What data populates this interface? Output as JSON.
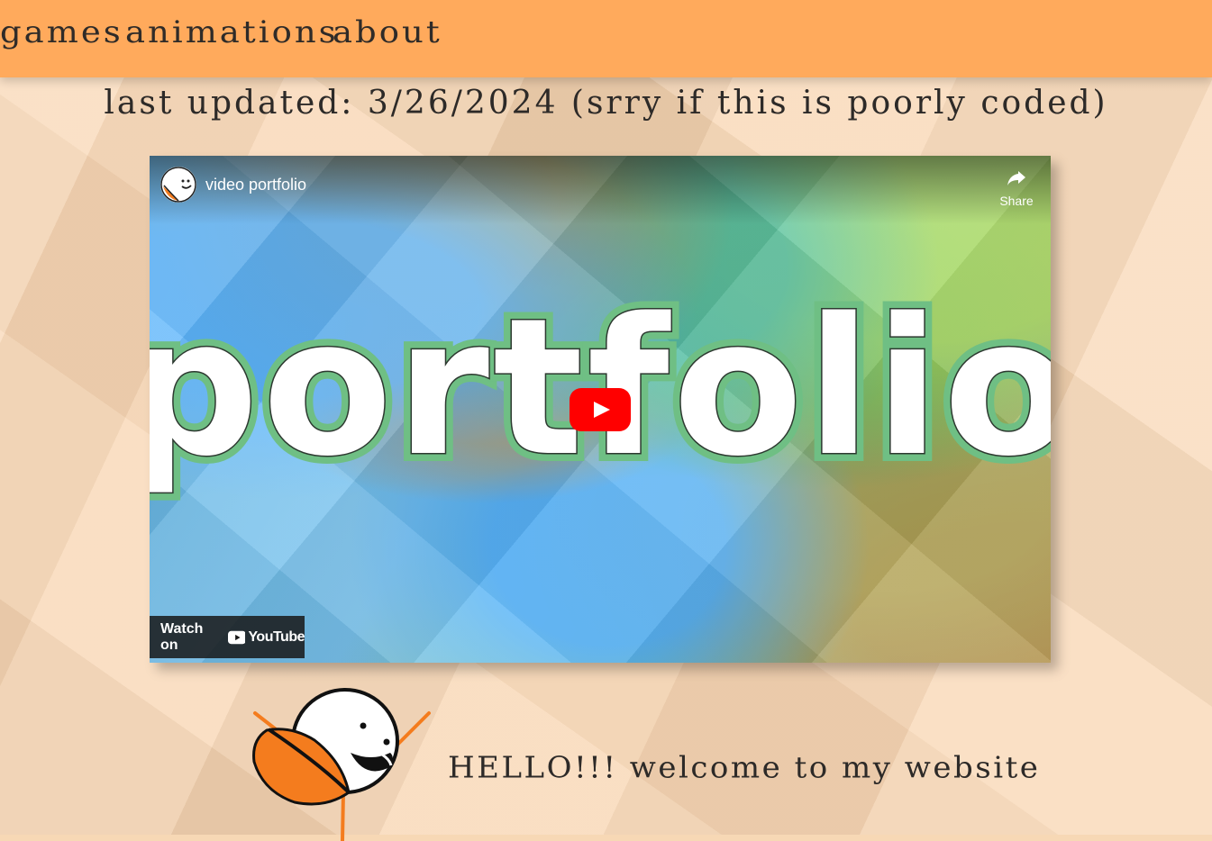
{
  "colors": {
    "navbar": "#ffaa5c",
    "page_background": "#f8d6b3",
    "text": "#2d2a28",
    "mascot_orange": "#f47c1e"
  },
  "nav": {
    "links": [
      "games",
      "animations",
      "about"
    ]
  },
  "header": {
    "updated": "last updated: 3/26/2024 (srry if this is poorly coded)"
  },
  "video": {
    "title": "video portfolio",
    "share_label": "Share",
    "thumbnail_text": "portfolio",
    "watch_label": "Watch on",
    "brand_label": "YouTube",
    "icons": {
      "share": "share-icon",
      "play": "play-icon",
      "brand": "youtube-logo-icon"
    }
  },
  "intro": {
    "welcome": "HELLO!!! welcome to my website"
  }
}
